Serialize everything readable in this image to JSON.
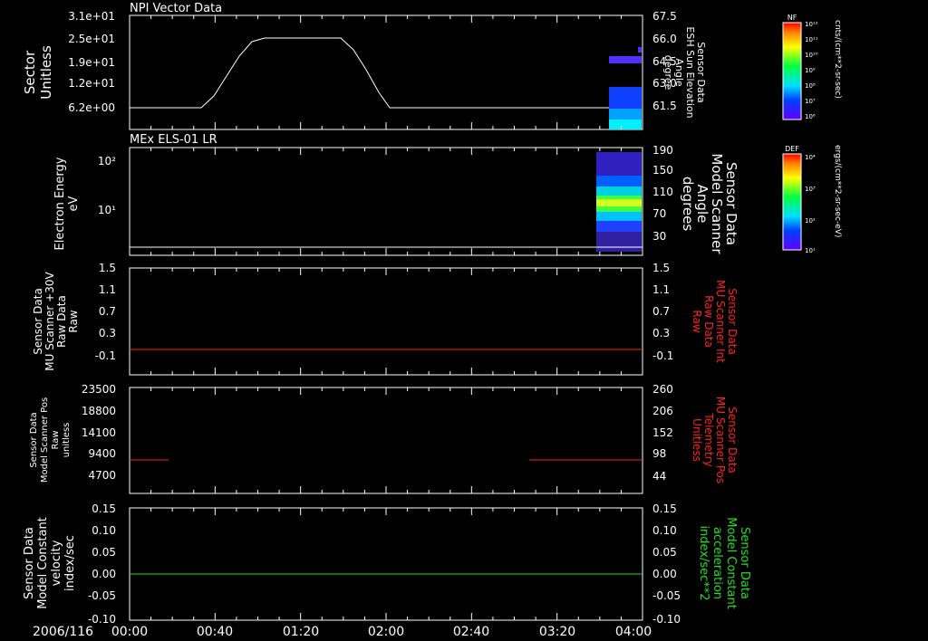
{
  "date_label": "2006/116",
  "time_ticks": [
    "00:00",
    "00:40",
    "01:20",
    "02:00",
    "02:40",
    "03:20",
    "04:00"
  ],
  "colors": {
    "white": "#ffffff",
    "red": "#ff2020",
    "green": "#20e020"
  },
  "colorbars": [
    {
      "label": "NF",
      "ticks": [
        "10¹²",
        "10¹¹",
        "10¹⁰",
        "10⁹",
        "10⁸",
        "10⁷",
        "10⁶"
      ],
      "units": "cnts/(cm**2-sr-sec)"
    },
    {
      "label": "DEF",
      "ticks": [
        "10⁴",
        "10³",
        "10²",
        "10¹"
      ],
      "units": "ergs/(cm**2-sr-sec-eV)"
    }
  ],
  "chart_data": [
    {
      "type": "line",
      "title": "NPI Vector Data",
      "ylabel": [
        "Sector",
        "Unitless"
      ],
      "y_ticks": [
        "3.1e+01",
        "2.5e+01",
        "1.9e+01",
        "1.2e+01",
        "6.2e+00"
      ],
      "y2label": [
        "Sensor Data",
        "ESH Sun Elevation",
        "Angle",
        "degree"
      ],
      "y2_ticks": [
        "67.5",
        "66.0",
        "64.5",
        "63.0",
        "61.5"
      ],
      "series": [
        {
          "color": "white",
          "x": [
            "00:00",
            "00:30",
            "00:42",
            "00:58",
            "01:22",
            "01:37",
            "01:52",
            "03:47"
          ],
          "values": [
            6.2,
            6.2,
            10.0,
            25.0,
            25.0,
            16.0,
            6.2,
            6.2
          ]
        }
      ]
    },
    {
      "type": "heatmap",
      "title": "MEx ELS-01 LR",
      "ylabel": [
        "Electron Energy",
        "eV"
      ],
      "y_ticks": [
        "10²",
        "10¹"
      ],
      "y2label": [
        "Sensor Data",
        "Model Scanner",
        "Angle",
        "degrees"
      ],
      "y2_ticks": [
        "190",
        "150",
        "110",
        "70",
        "30"
      ]
    },
    {
      "type": "line",
      "ylabel": [
        "Sensor Data",
        "MU Scanner +30V",
        "Raw Data",
        "Raw"
      ],
      "y_ticks": [
        "1.5",
        "1.1",
        "0.7",
        "0.3",
        "-0.1"
      ],
      "y2label": [
        "Sensor Data",
        "MU Scanner Int",
        "Raw Data",
        "Raw"
      ],
      "y2_ticks": [
        "1.5",
        "1.1",
        "0.7",
        "0.3",
        "-0.1"
      ],
      "ylim": [
        -0.3,
        1.5
      ],
      "series": [
        {
          "color": "red",
          "x": [
            "00:00",
            "04:00"
          ],
          "values": [
            0.0,
            0.0
          ]
        }
      ]
    },
    {
      "type": "line",
      "ylabel": [
        "Sensor Data",
        "Model Scanner Pos",
        "Raw",
        "unitless"
      ],
      "y_ticks": [
        "23500",
        "18800",
        "14100",
        "9400",
        "4700"
      ],
      "y2label": [
        "Sensor Data",
        "MU Scanner Pos",
        "Telemetry",
        "Unitless"
      ],
      "y2_ticks": [
        "260",
        "206",
        "152",
        "98",
        "44"
      ],
      "ylim": [
        0,
        23500
      ],
      "series": [
        {
          "color": "red",
          "x": [
            "00:00",
            "00:20"
          ],
          "values": [
            8000,
            8000
          ]
        },
        {
          "color": "red",
          "x": [
            "03:12",
            "04:00"
          ],
          "values": [
            8000,
            8000
          ]
        }
      ]
    },
    {
      "type": "line",
      "ylabel": [
        "Sensor Data",
        "Model Constant",
        "velocity",
        "index/sec"
      ],
      "y_ticks": [
        "0.15",
        "0.10",
        "0.05",
        "0.00",
        "-0.05",
        "-0.10"
      ],
      "y2label": [
        "Sensor Data",
        "Model Constant",
        "acceleration",
        "index/sec**2"
      ],
      "y2_ticks": [
        "0.15",
        "0.10",
        "0.05",
        "0.00",
        "-0.05",
        "-0.10"
      ],
      "ylim": [
        -0.1,
        0.15
      ],
      "series": [
        {
          "color": "green",
          "x": [
            "00:00",
            "04:00"
          ],
          "values": [
            0.0,
            0.0
          ]
        }
      ]
    }
  ]
}
